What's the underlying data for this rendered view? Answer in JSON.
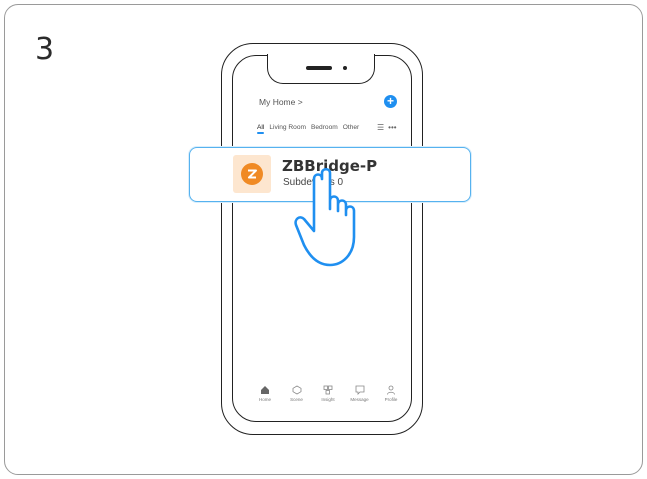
{
  "step": {
    "number": "3"
  },
  "app": {
    "home_title": "My Home  >",
    "add_icon": "plus-icon",
    "tabs": [
      {
        "label": "All",
        "active": true
      },
      {
        "label": "Living Room",
        "active": false
      },
      {
        "label": "Bedroom",
        "active": false
      },
      {
        "label": "Other",
        "active": false
      }
    ],
    "tab_icons": [
      "list-icon",
      "more-icon"
    ],
    "tab_more": "•••",
    "tab_list": "☰"
  },
  "device": {
    "name": "ZBBridge-P",
    "subtitle": "Subdevices 0",
    "icon": "zigbee-icon"
  },
  "bottom_nav": [
    {
      "label": "Home",
      "icon": "home-icon"
    },
    {
      "label": "Scene",
      "icon": "scene-icon"
    },
    {
      "label": "Insight",
      "icon": "insight-icon"
    },
    {
      "label": "Message",
      "icon": "message-icon"
    },
    {
      "label": "Profile",
      "icon": "profile-icon"
    }
  ],
  "colors": {
    "accent": "#1f8ff0",
    "highlight_border": "#56b2ef",
    "device_orange": "#f08a24",
    "device_bg": "#fde6cf"
  }
}
